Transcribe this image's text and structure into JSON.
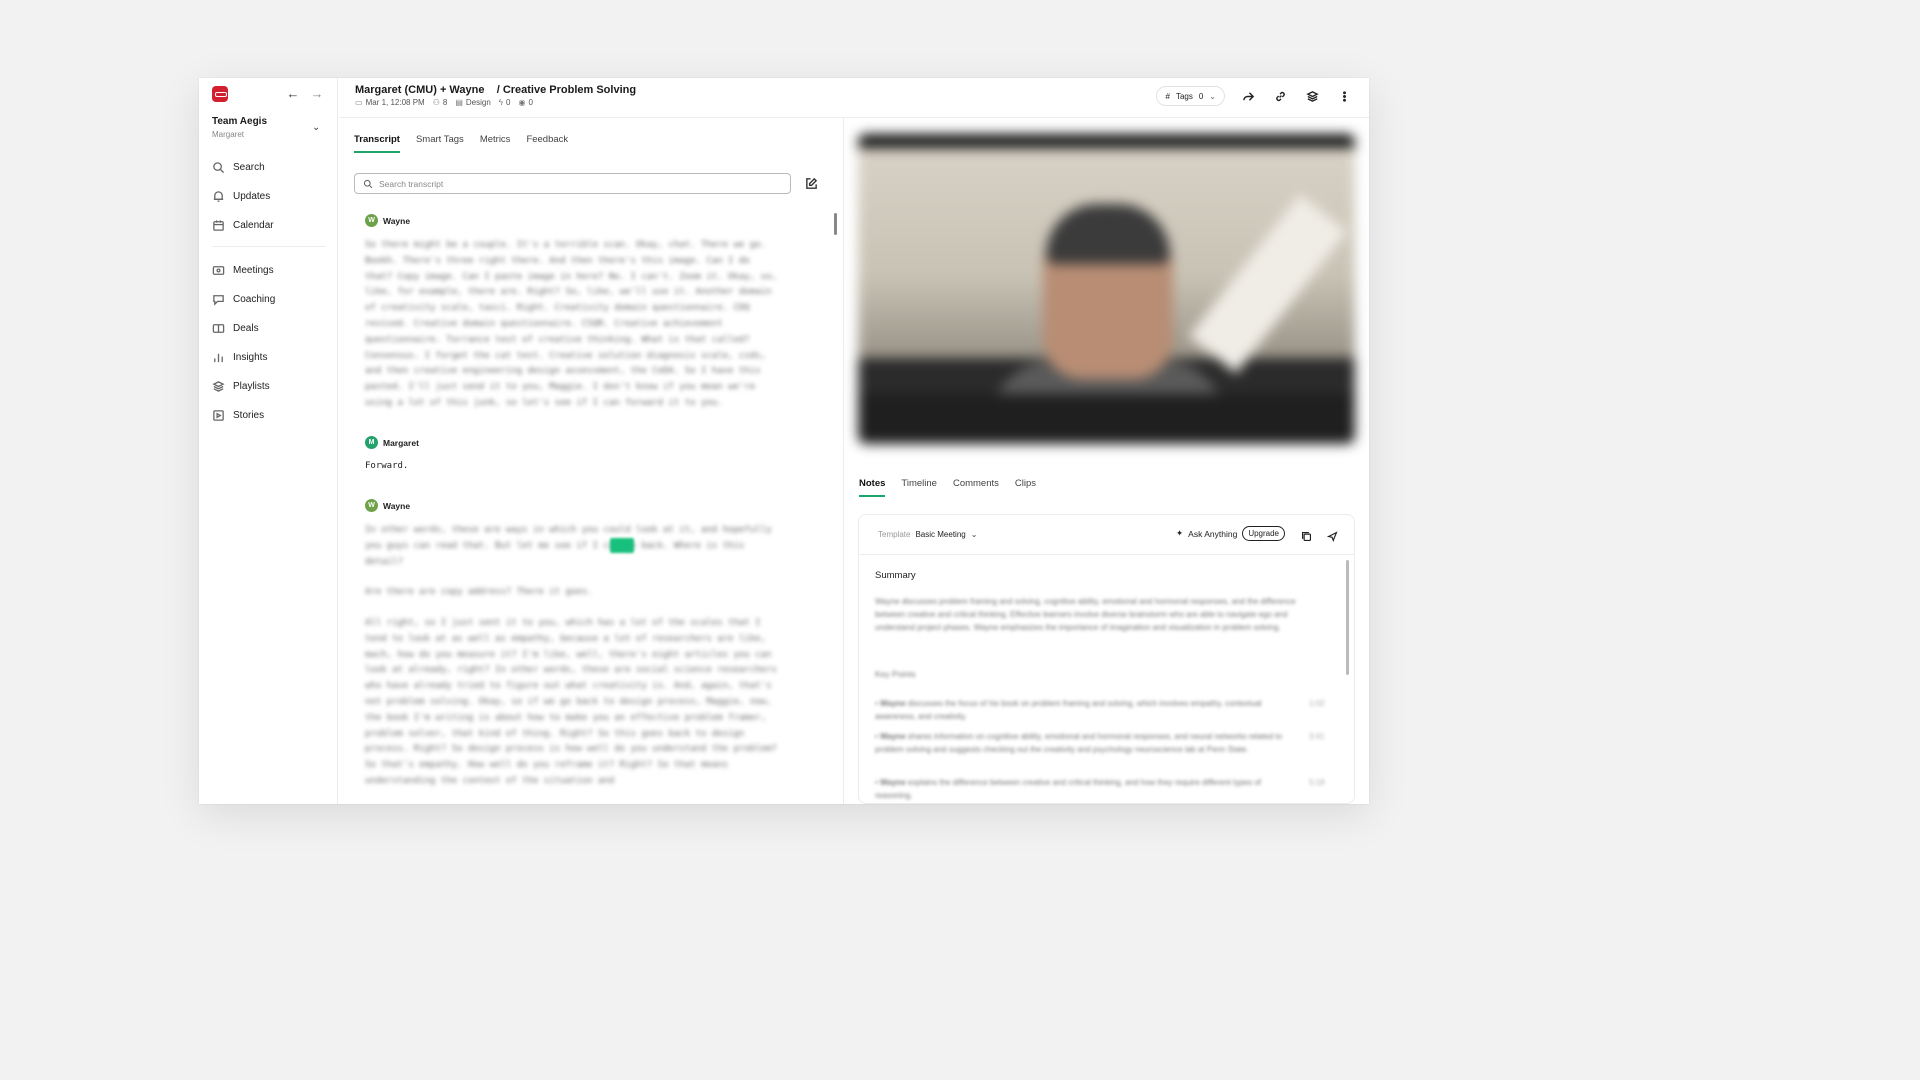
{
  "sidebar": {
    "team_name": "Team Aegis",
    "team_user": "Margaret",
    "nav_primary": [
      {
        "label": "Search",
        "icon": "search-icon"
      },
      {
        "label": "Updates",
        "icon": "bell-icon"
      },
      {
        "label": "Calendar",
        "icon": "calendar-icon"
      }
    ],
    "nav_secondary": [
      {
        "label": "Meetings",
        "icon": "meetings-icon"
      },
      {
        "label": "Coaching",
        "icon": "coaching-icon"
      },
      {
        "label": "Deals",
        "icon": "deals-icon"
      },
      {
        "label": "Insights",
        "icon": "insights-icon"
      },
      {
        "label": "Playlists",
        "icon": "playlists-icon"
      },
      {
        "label": "Stories",
        "icon": "stories-icon"
      }
    ]
  },
  "header": {
    "title": "Margaret (CMU) + Wayne    / Creative Problem Solving",
    "date": "Mar 1, 12:08 PM",
    "participants": "8",
    "category": "Design",
    "signals": "0",
    "views": "0",
    "tags_label": "Tags",
    "tags_count": "0"
  },
  "transcript_tabs": [
    "Transcript",
    "Smart Tags",
    "Metrics",
    "Feedback"
  ],
  "search": {
    "placeholder": "Search transcript"
  },
  "transcript": [
    {
      "speaker": "Wayne",
      "initial": "W",
      "text": "So there might be a couple. It's a terrible scan. Okay, chat. There we go. Bookh. There's three right there. And then there's this image. Can I do that? Copy image. Can I paste image in here? No. I can't. Zoom it. Okay, so, like, for example, there are. Right? So, like, we'll use it. Another domain of creativity scale, tasci. Right. Creativity domain questionnaire. CDQ revised. Creative domain questionnaire. CSQR. Creative achievement questionnaire. Torrance test of creative thinking. What is that called? Consensus. I forget the cat test. Creative solution diagnosis scale, csds, and then creative engineering design assessment, the CeDA. So I have this pasted. I'll just send it to you, Maggie. I don't know if you mean we're using a lot of this junk, so let's see if I can forward it to you."
    },
    {
      "speaker": "Margaret",
      "initial": "M",
      "text": "Forward."
    },
    {
      "speaker": "Wayne",
      "initial": "W",
      "text": "In other words, these are ways in which you could look at it, and hopefully you guys can read that. But let me see if I can go back. Where is this detail?",
      "text2": "Are there are copy address? There it goes.",
      "text3": "All right, so I just sent it to you, which has a lot of the scales that I tend to look at as well as empathy, because a lot of researchers are like, mach, how do you measure it? I'm like, well, there's eight articles you can look at already, right? In other words, these are social science researchers who have already tried to figure out what creativity is. And, again, that's not problem solving. Okay, so if we go back to design process, Maggie, now, the book I'm writing is about how to make you an effective problem framer, problem solver, that kind of thing. Right? So this goes back to design process. Right? So design process is how well do you understand the problem? So that's empathy. How well do you reframe it? Right? So that means understanding the context of the situation and"
    }
  ],
  "right_tabs": [
    "Notes",
    "Timeline",
    "Comments",
    "Clips"
  ],
  "notes": {
    "template_label": "Template",
    "template_value": "Basic Meeting",
    "ask_label": "Ask Anything",
    "upgrade_label": "Upgrade",
    "summary_heading": "Summary",
    "summary_text": "Wayne discusses problem framing and solving, cognitive ability, emotional and hormonal responses, and the difference between creative and critical thinking. Effective learners involve diverse brainstorm who are able to navigate ego and understand project phases. Wayne emphasizes the importance of imagination and visualization in problem solving.",
    "key_points_heading": "Key Points",
    "key_points": [
      {
        "name": "Wayne",
        "text": "discusses the focus of his book on problem framing and solving, which involves empathy, contextual awareness, and creativity.",
        "time": "1:02"
      },
      {
        "name": "Wayne",
        "text": "shares information on cognitive ability, emotional and hormonal responses, and neural networks related to problem solving and suggests checking out the creativity and psychology neuroscience lab at Penn State.",
        "time": "3:41"
      },
      {
        "name": "Wayne",
        "text": "explains the difference between creative and critical thinking, and how they require different types of reasoning.",
        "time": "5:18"
      }
    ]
  },
  "colors": {
    "accent": "#1aa56b",
    "brand": "#d2202f"
  }
}
